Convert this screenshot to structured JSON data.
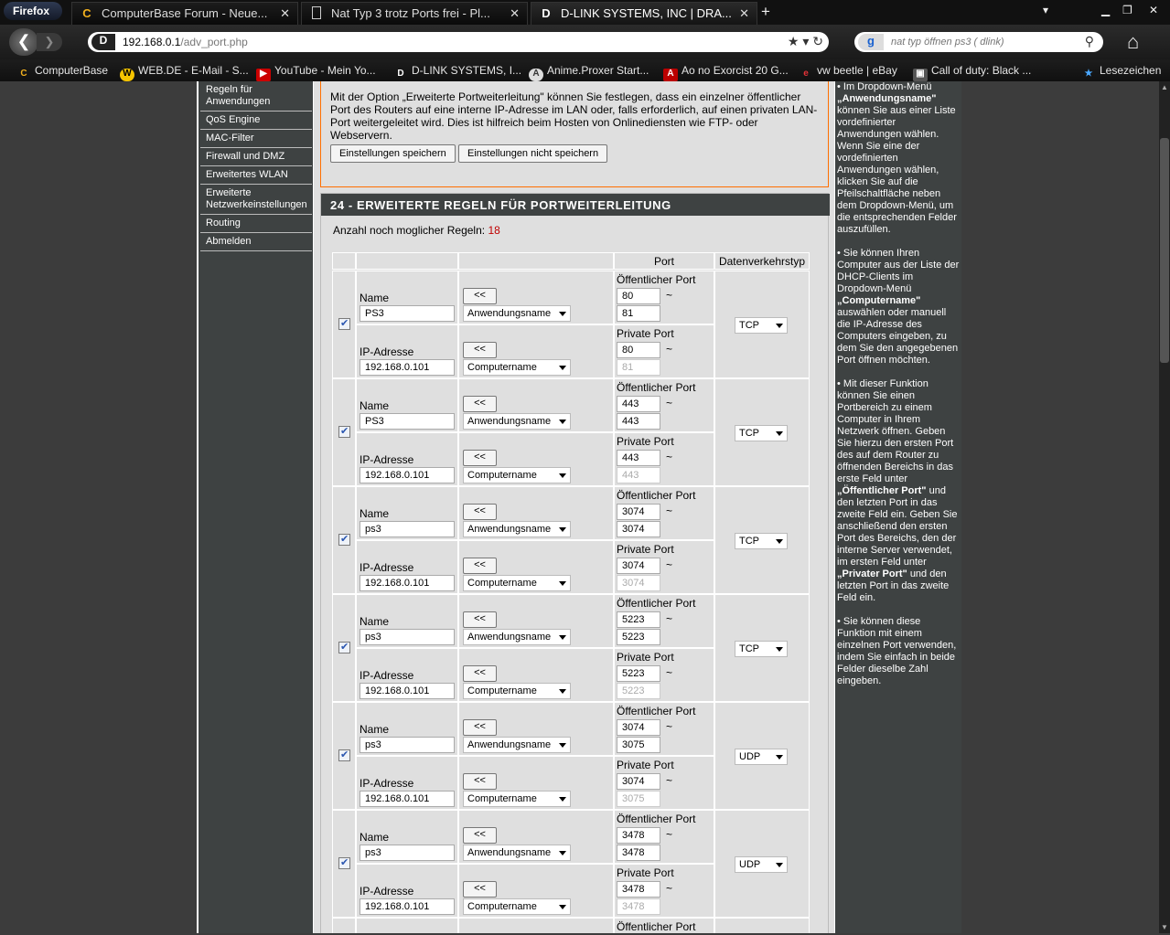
{
  "browser": {
    "app_button": "Firefox",
    "tabs": [
      {
        "icon": "computerbase",
        "label": "ComputerBase Forum - Neue..."
      },
      {
        "icon": "document",
        "label": "Nat Typ 3 trotz Ports frei - Pl..."
      },
      {
        "icon": "dlink",
        "label": "D-LINK SYSTEMS, INC | DRA..."
      }
    ],
    "url_host": "192.168.0.1",
    "url_path": "/adv_port.php",
    "search_placeholder": "nat typ öffnen ps3 ( dlink)",
    "bookmarks": [
      {
        "icon": "computerbase",
        "label": "ComputerBase"
      },
      {
        "icon": "webde",
        "label": "WEB.DE - E-Mail - S..."
      },
      {
        "icon": "youtube",
        "label": "YouTube - Mein Yo..."
      },
      {
        "icon": "dlink",
        "label": "D-LINK SYSTEMS, I..."
      },
      {
        "icon": "anime",
        "label": "Anime.Proxer Start..."
      },
      {
        "icon": "ao",
        "label": "Ao no Exorcist 20 G..."
      },
      {
        "icon": "ebay",
        "label": "vw beetle | eBay"
      },
      {
        "icon": "cod",
        "label": "Call of duty: Black ..."
      }
    ],
    "bookmarks_menu": "Lesezeichen"
  },
  "leftnav": {
    "items": [
      "Regeln für Anwendungen",
      "QoS Engine",
      "MAC-Filter",
      "Firewall und DMZ",
      "Erweitertes WLAN",
      "Erweiterte Netzwerkeinstellungen",
      "Routing",
      "Abmelden"
    ]
  },
  "intro": {
    "text": "Mit der Option „Erweiterte Portweiterleitung\" können Sie festlegen, dass ein einzelner öffentlicher Port des Routers auf eine interne IP-Adresse im LAN oder, falls erforderlich, auf einen privaten LAN-Port weitergeleitet wird. Dies ist hilfreich beim Hosten von Onlinediensten wie FTP- oder Webservern.",
    "save_button": "Einstellungen speichern",
    "dont_save_button": "Einstellungen nicht speichern"
  },
  "rules": {
    "header": "24 - ERWEITERTE REGELN FÜR PORTWEITERLEITUNG",
    "remaining_label": "Anzahl noch moglicher Regeln:",
    "remaining_count": "18",
    "col_port": "Port",
    "col_traffic": "Datenverkehrstyp",
    "label_name": "Name",
    "label_ip": "IP-Adresse",
    "label_public_port": "Öffentlicher Port",
    "label_private_port": "Private Port",
    "copy_button": "<<",
    "app_select": "Anwendungsname",
    "computer_select": "Computername",
    "tilde": "~",
    "rows": [
      {
        "name": "PS3",
        "ip": "192.168.0.101",
        "pub_start": "80",
        "pub_end": "81",
        "priv_start": "80",
        "priv_end": "81",
        "traffic": "TCP"
      },
      {
        "name": "PS3",
        "ip": "192.168.0.101",
        "pub_start": "443",
        "pub_end": "443",
        "priv_start": "443",
        "priv_end": "443",
        "traffic": "TCP"
      },
      {
        "name": "ps3",
        "ip": "192.168.0.101",
        "pub_start": "3074",
        "pub_end": "3074",
        "priv_start": "3074",
        "priv_end": "3074",
        "traffic": "TCP"
      },
      {
        "name": "ps3",
        "ip": "192.168.0.101",
        "pub_start": "5223",
        "pub_end": "5223",
        "priv_start": "5223",
        "priv_end": "5223",
        "traffic": "TCP"
      },
      {
        "name": "ps3",
        "ip": "192.168.0.101",
        "pub_start": "3074",
        "pub_end": "3075",
        "priv_start": "3074",
        "priv_end": "3075",
        "traffic": "UDP"
      },
      {
        "name": "ps3",
        "ip": "192.168.0.101",
        "pub_start": "3478",
        "pub_end": "3478",
        "priv_start": "3478",
        "priv_end": "3478",
        "traffic": "UDP"
      }
    ],
    "partial_label": "Öffentlicher Port"
  },
  "help": {
    "p1_a": "• Im Dropdown-Menü",
    "p1_b": "„Anwendungsname\"",
    "p1_c": "können Sie aus einer Liste vordefinierter Anwendungen wählen. Wenn Sie eine der vordefinierten Anwendungen wählen, klicken Sie auf die Pfeilschaltfläche neben dem Dropdown-Menü, um die entsprechenden Felder auszufüllen.",
    "p2_a": "• Sie können Ihren Computer aus der Liste der DHCP-Clients im Dropdown-Menü",
    "p2_b": "„Computername\"",
    "p2_c": "auswählen oder manuell die IP-Adresse des Computers eingeben, zu dem Sie den angegebenen Port öffnen möchten.",
    "p3_a": "• Mit dieser Funktion können Sie einen Portbereich zu einem Computer in Ihrem Netzwerk öffnen. Geben Sie hierzu den ersten Port des auf dem Router zu öffnenden Bereichs in das erste Feld unter",
    "p3_b": "„Öffentlicher Port\"",
    "p3_c": "und den letzten Port in das zweite Feld ein. Geben Sie anschließend den ersten Port des Bereichs, den der interne Server verwendet, im ersten Feld unter",
    "p3_d": "„Privater Port\"",
    "p3_e": "und den letzten Port in das zweite Feld ein.",
    "p4": "• Sie können diese Funktion mit einem einzelnen Port verwenden, indem Sie einfach in beide Felder dieselbe Zahl eingeben."
  }
}
